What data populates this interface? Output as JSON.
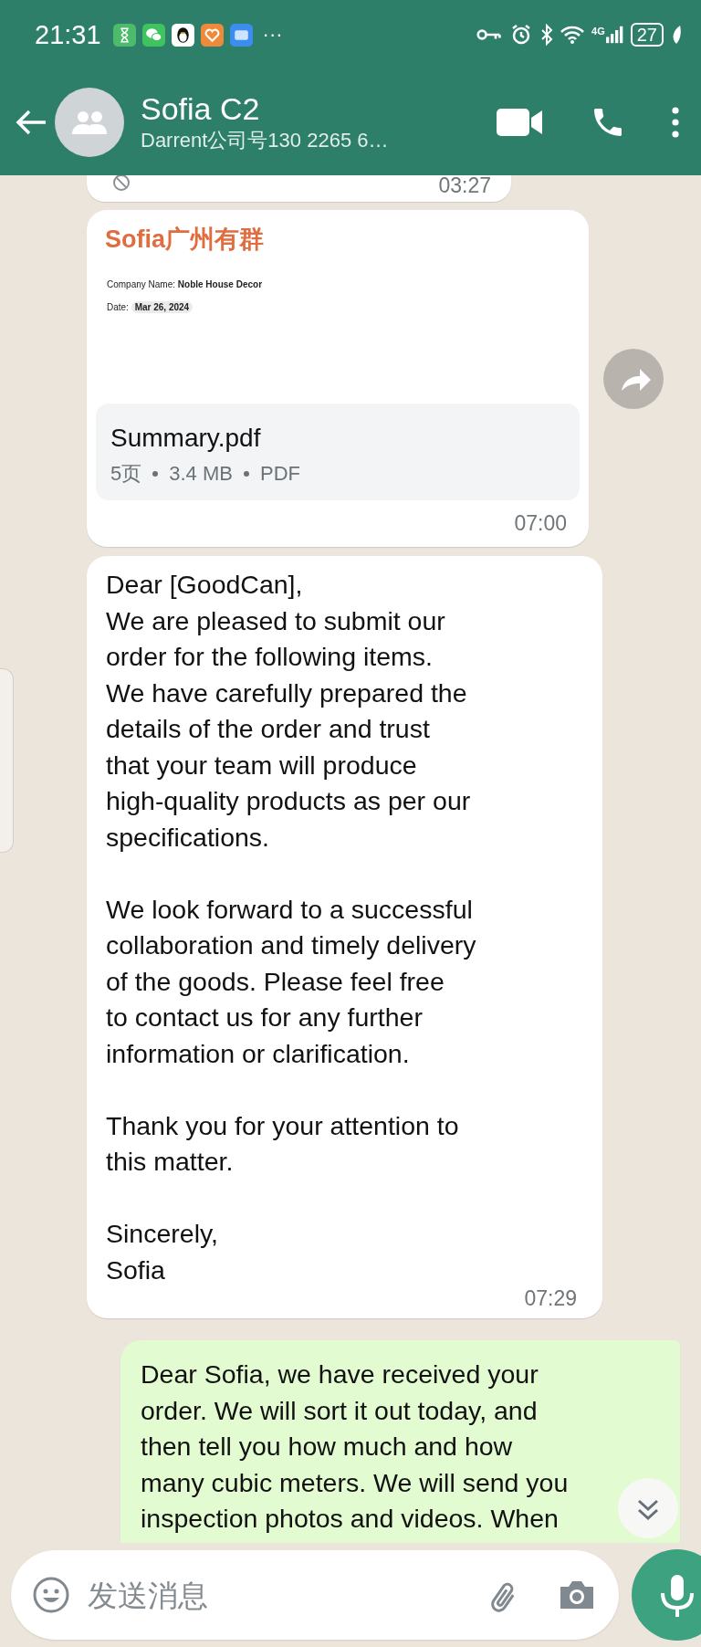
{
  "status_bar": {
    "time": "21:31",
    "more": "···",
    "battery": "27",
    "network": "4G"
  },
  "header": {
    "title": "Sofia C2",
    "subtitle": "Darrent公司号130 2265 6…"
  },
  "messages": [
    {
      "kind": "deleted",
      "time": "03:27"
    },
    {
      "kind": "document",
      "sender": "Sofia广州有群",
      "preview": {
        "company_label": "Company Name:",
        "company": "Noble House Decor",
        "date_label": "Date:",
        "date": "Mar 26, 2024"
      },
      "file_name": "Summary.pdf",
      "pages": "5页",
      "size": "3.4 MB",
      "type": "PDF",
      "time": "07:00"
    },
    {
      "kind": "text",
      "paragraphs": [
        "Dear [GoodCan],\nWe are pleased to submit our\norder for the following items.\nWe have carefully prepared the\ndetails of the order and trust\nthat your team will produce\nhigh-quality products as per our\nspecifications.",
        "We look forward to a successful\ncollaboration and timely delivery\nof the goods. Please feel free\nto contact us for any further\ninformation or clarification.",
        "Thank you for your attention to\nthis matter.",
        "Sincerely,\nSofia"
      ],
      "time": "07:29"
    },
    {
      "kind": "outgoing",
      "paragraphs": [
        "Dear Sofia, we have received your\norder. We will sort it out today, and\nthen tell you how much and how\nmany cubic meters. We will send you\ninspection photos and videos. When"
      ]
    }
  ],
  "composer": {
    "placeholder": "发送消息"
  }
}
